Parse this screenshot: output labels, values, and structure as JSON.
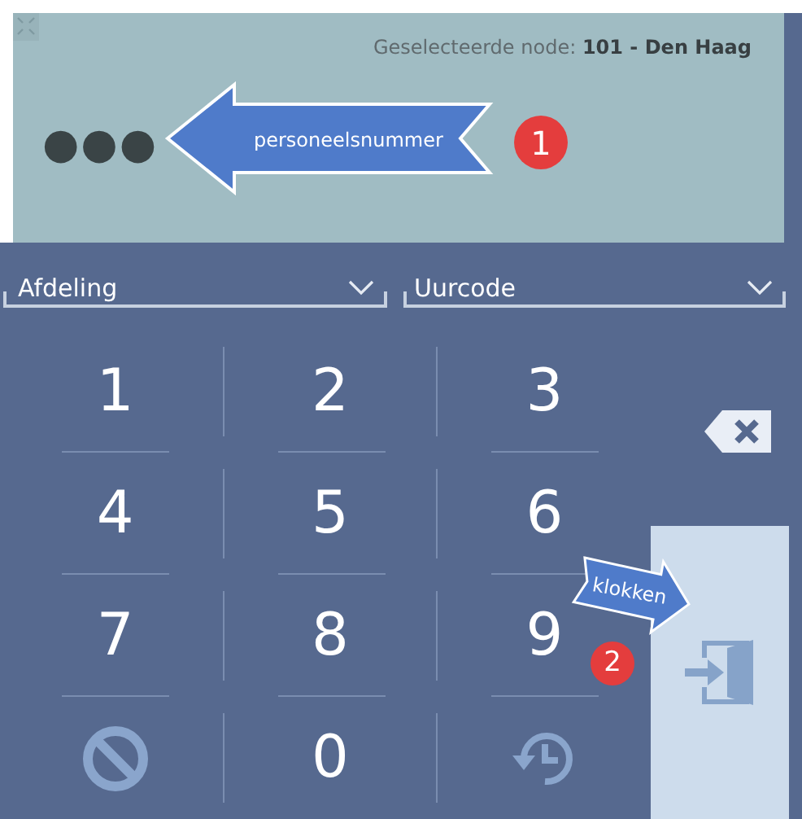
{
  "header": {
    "label": "Geselecteerde node:",
    "value": "101 - Den Haag"
  },
  "pin_display": {
    "value": "●●●"
  },
  "callouts": [
    {
      "label": "personeelsnummer",
      "number": "1"
    },
    {
      "label": "klokken",
      "number": "2"
    }
  ],
  "dropdowns": [
    {
      "placeholder": "Afdeling"
    },
    {
      "placeholder": "Uurcode"
    }
  ],
  "keys": [
    {
      "kind": "digit",
      "label": "1"
    },
    {
      "kind": "digit",
      "label": "2"
    },
    {
      "kind": "digit",
      "label": "3"
    },
    {
      "kind": "digit",
      "label": "4"
    },
    {
      "kind": "digit",
      "label": "5"
    },
    {
      "kind": "digit",
      "label": "6"
    },
    {
      "kind": "digit",
      "label": "7"
    },
    {
      "kind": "digit",
      "label": "8"
    },
    {
      "kind": "digit",
      "label": "9"
    },
    {
      "kind": "clear"
    },
    {
      "kind": "digit",
      "label": "0"
    },
    {
      "kind": "history"
    }
  ]
}
